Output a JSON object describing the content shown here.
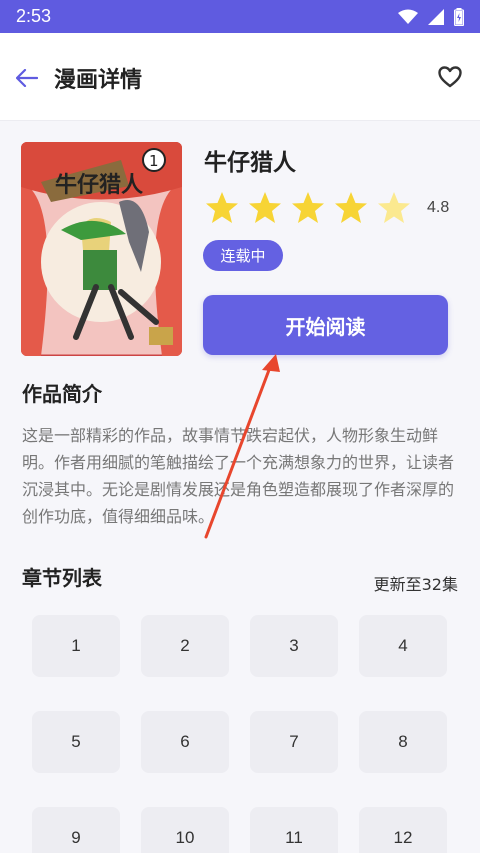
{
  "status_bar": {
    "time": "2:53"
  },
  "app_bar": {
    "title": "漫画详情"
  },
  "book": {
    "title": "牛仔猎人",
    "rating": "4.8",
    "rating_stars": 4.5,
    "status_badge": "连载中",
    "read_button_label": "开始阅读"
  },
  "intro": {
    "heading": "作品简介",
    "text": "这是一部精彩的作品，故事情节跌宕起伏，人物形象生动鲜明。作者用细腻的笔触描绘了一个充满想象力的世界，让读者沉浸其中。无论是剧情发展还是角色塑造都展现了作者深厚的创作功底，值得细细品味。"
  },
  "chapters": {
    "heading": "章节列表",
    "updated": "更新至32集",
    "items": [
      "1",
      "2",
      "3",
      "4",
      "5",
      "6",
      "7",
      "8",
      "9",
      "10",
      "11",
      "12"
    ]
  },
  "colors": {
    "accent": "#6461e2",
    "star": "#f7d435",
    "star_light": "#fbe98f"
  }
}
